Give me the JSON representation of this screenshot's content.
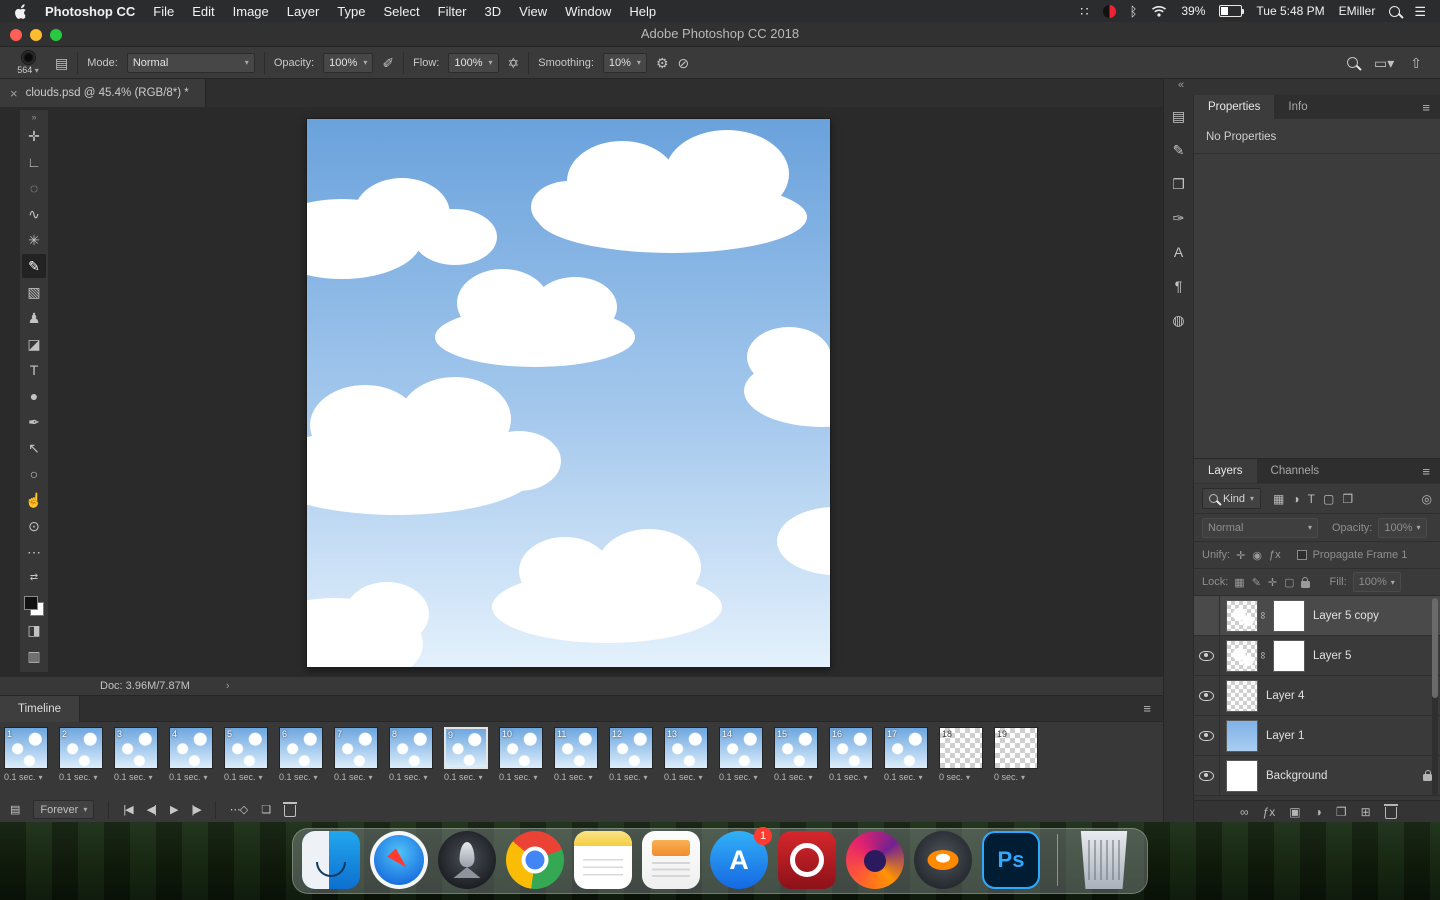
{
  "menubar": {
    "app_name": "Photoshop CC",
    "menus": [
      "File",
      "Edit",
      "Image",
      "Layer",
      "Type",
      "Select",
      "Filter",
      "3D",
      "View",
      "Window",
      "Help"
    ],
    "battery_pct": "39%",
    "clock": "Tue 5:48 PM",
    "user": "EMiller"
  },
  "titlebar": {
    "title": "Adobe Photoshop CC 2018"
  },
  "options_bar": {
    "brush_size": "564",
    "mode_label": "Mode:",
    "mode_value": "Normal",
    "opacity_label": "Opacity:",
    "opacity_value": "100%",
    "flow_label": "Flow:",
    "flow_value": "100%",
    "smoothing_label": "Smoothing:",
    "smoothing_value": "10%"
  },
  "doc_tab": {
    "close_glyph": "×",
    "title": "clouds.psd @ 45.4% (RGB/8*) *"
  },
  "tools": [
    {
      "name": "move-tool",
      "glyph": "✛",
      "selected": false
    },
    {
      "name": "crop-tool",
      "glyph": "∟",
      "selected": false
    },
    {
      "name": "marquee-tool",
      "glyph": "◌",
      "selected": false
    },
    {
      "name": "lasso-tool",
      "glyph": "∿",
      "selected": false
    },
    {
      "name": "magic-wand-tool",
      "glyph": "✳",
      "selected": false
    },
    {
      "name": "brush-tool",
      "glyph": "✎",
      "selected": true
    },
    {
      "name": "gradient-tool",
      "glyph": "▧",
      "selected": false
    },
    {
      "name": "clone-stamp-tool",
      "glyph": "♟",
      "selected": false
    },
    {
      "name": "eraser-tool",
      "glyph": "◪",
      "selected": false
    },
    {
      "name": "type-tool",
      "glyph": "T",
      "selected": false
    },
    {
      "name": "blur-tool",
      "glyph": "●",
      "selected": false
    },
    {
      "name": "pen-tool",
      "glyph": "✒",
      "selected": false
    },
    {
      "name": "path-select-tool",
      "glyph": "↖",
      "selected": false
    },
    {
      "name": "shape-tool",
      "glyph": "○",
      "selected": false
    },
    {
      "name": "hand-tool",
      "glyph": "☝",
      "selected": false
    },
    {
      "name": "zoom-tool",
      "glyph": "⊙",
      "selected": false
    },
    {
      "name": "more-tools",
      "glyph": "⋯",
      "selected": false
    }
  ],
  "panel_strip": [
    {
      "name": "swatches-panel",
      "glyph": "▤"
    },
    {
      "name": "brush-settings-panel",
      "glyph": "✎"
    },
    {
      "name": "clone-source-panel",
      "glyph": "❐"
    },
    {
      "name": "tool-presets-panel",
      "glyph": "✑"
    },
    {
      "name": "character-panel",
      "glyph": "A"
    },
    {
      "name": "paragraph-panel",
      "glyph": "¶"
    },
    {
      "name": "libraries-panel",
      "glyph": "◍"
    }
  ],
  "properties_panel": {
    "tab_properties": "Properties",
    "tab_info": "Info",
    "empty_text": "No Properties"
  },
  "layers_panel": {
    "tab_layers": "Layers",
    "tab_channels": "Channels",
    "filter_label": "Kind",
    "filter_icons": [
      {
        "name": "filter-pixel-layers-icon",
        "glyph": "▦"
      },
      {
        "name": "filter-adjustment-layers-icon",
        "glyph": "◑"
      },
      {
        "name": "filter-type-layers-icon",
        "glyph": "T"
      },
      {
        "name": "filter-shape-layers-icon",
        "glyph": "▢"
      },
      {
        "name": "filter-smart-objects-icon",
        "glyph": "❐"
      }
    ],
    "blend_mode": "Normal",
    "opacity_label": "Opacity:",
    "opacity_value": "100%",
    "unify_label": "Unify:",
    "unify_icons": [
      {
        "name": "unify-position-icon",
        "glyph": "✛"
      },
      {
        "name": "unify-visibility-icon",
        "glyph": "◉"
      },
      {
        "name": "unify-style-icon",
        "glyph": "ƒx"
      }
    ],
    "propagate_label": "Propagate Frame 1",
    "lock_label": "Lock:",
    "lock_icons": [
      {
        "name": "lock-transparency-icon",
        "glyph": "▦"
      },
      {
        "name": "lock-pixels-icon",
        "glyph": "✎"
      },
      {
        "name": "lock-position-icon",
        "glyph": "✛"
      },
      {
        "name": "lock-artboard-icon",
        "glyph": "▢"
      }
    ],
    "fill_label": "Fill:",
    "fill_value": "100%",
    "layers": [
      {
        "name": "Layer 5 copy",
        "visible": false,
        "selected": true,
        "thumb": "clouds",
        "mask": true,
        "locked": false
      },
      {
        "name": "Layer 5",
        "visible": true,
        "selected": false,
        "thumb": "clouds",
        "mask": true,
        "locked": false
      },
      {
        "name": "Layer 4",
        "visible": true,
        "selected": false,
        "thumb": "checker",
        "mask": false,
        "locked": false
      },
      {
        "name": "Layer 1",
        "visible": true,
        "selected": false,
        "thumb": "blue",
        "mask": false,
        "locked": false
      },
      {
        "name": "Background",
        "visible": true,
        "selected": false,
        "thumb": "white",
        "mask": false,
        "locked": true
      }
    ],
    "bottom_icons": [
      {
        "name": "link-layers-icon",
        "glyph": "∞"
      },
      {
        "name": "layer-style-icon",
        "glyph": "ƒx"
      },
      {
        "name": "add-mask-icon",
        "glyph": "▣"
      },
      {
        "name": "adjustment-layer-icon",
        "glyph": "◑"
      },
      {
        "name": "new-group-icon",
        "glyph": "❐"
      },
      {
        "name": "new-layer-icon",
        "glyph": "⊞"
      },
      {
        "name": "delete-layer-icon",
        "glyph": "trash"
      }
    ]
  },
  "status_bar": {
    "doc_label": "Doc: 3.96M/7.87M",
    "chevron": "›"
  },
  "timeline": {
    "tab_label": "Timeline",
    "loop_label": "Forever",
    "frames": [
      {
        "num": "1",
        "duration": "0.1 sec.",
        "selected": false,
        "thumb": "sky"
      },
      {
        "num": "2",
        "duration": "0.1 sec.",
        "selected": false,
        "thumb": "sky"
      },
      {
        "num": "3",
        "duration": "0.1 sec.",
        "selected": false,
        "thumb": "sky"
      },
      {
        "num": "4",
        "duration": "0.1 sec.",
        "selected": false,
        "thumb": "sky"
      },
      {
        "num": "5",
        "duration": "0.1 sec.",
        "selected": false,
        "thumb": "sky"
      },
      {
        "num": "6",
        "duration": "0.1 sec.",
        "selected": false,
        "thumb": "sky"
      },
      {
        "num": "7",
        "duration": "0.1 sec.",
        "selected": false,
        "thumb": "sky"
      },
      {
        "num": "8",
        "duration": "0.1 sec.",
        "selected": false,
        "thumb": "sky"
      },
      {
        "num": "9",
        "duration": "0.1 sec.",
        "selected": true,
        "thumb": "sky"
      },
      {
        "num": "10",
        "duration": "0.1 sec.",
        "selected": false,
        "thumb": "sky"
      },
      {
        "num": "11",
        "duration": "0.1 sec.",
        "selected": false,
        "thumb": "sky"
      },
      {
        "num": "12",
        "duration": "0.1 sec.",
        "selected": false,
        "thumb": "sky"
      },
      {
        "num": "13",
        "duration": "0.1 sec.",
        "selected": false,
        "thumb": "sky"
      },
      {
        "num": "14",
        "duration": "0.1 sec.",
        "selected": false,
        "thumb": "sky"
      },
      {
        "num": "15",
        "duration": "0.1 sec.",
        "selected": false,
        "thumb": "sky"
      },
      {
        "num": "16",
        "duration": "0.1 sec.",
        "selected": false,
        "thumb": "sky"
      },
      {
        "num": "17",
        "duration": "0.1 sec.",
        "selected": false,
        "thumb": "sky"
      },
      {
        "num": "18",
        "duration": "0 sec.",
        "selected": false,
        "thumb": "checker"
      },
      {
        "num": "19",
        "duration": "0 sec.",
        "selected": false,
        "thumb": "checker"
      }
    ]
  },
  "dock": {
    "apps": [
      {
        "name": "finder"
      },
      {
        "name": "safari"
      },
      {
        "name": "launchpad"
      },
      {
        "name": "chrome"
      },
      {
        "name": "notes"
      },
      {
        "name": "pages"
      },
      {
        "name": "app-store",
        "glyph": "A",
        "badge": "1"
      },
      {
        "name": "creative-cloud"
      },
      {
        "name": "firefox"
      },
      {
        "name": "blender"
      },
      {
        "name": "photoshop",
        "glyph": "Ps"
      },
      {
        "name": "trash"
      }
    ]
  }
}
